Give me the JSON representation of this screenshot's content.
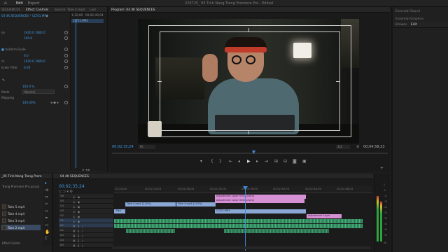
{
  "menu": {
    "home_label": "",
    "edit": "Edit",
    "export": "Export"
  },
  "app_title": "220725_ 05 Tinh Nang Trong Premiere Pro - Edited",
  "left_panel": {
    "tabs": [
      "SEQUENCES",
      "Effect Controls",
      "Source: Take 4.mp4",
      "Lum"
    ],
    "source_label": "04 4K SEQUENCES",
    "clip_label": "04 4K SEQUENCES * CLT01.MP4",
    "timecode_in": "1;32;00",
    "timecode_out": "00;02;40;04",
    "clip_strip": "CLT01.MP4",
    "properties": [
      {
        "label": "on",
        "value": "1920.0   1080.0"
      },
      {
        "label": "",
        "value": "100.0"
      },
      {
        "label": "",
        "value": ""
      },
      {
        "label": "",
        "value": "Uniform Scale"
      },
      {
        "label": "",
        "value": "0.0"
      },
      {
        "label": "nt",
        "value": "1920.0   1080.0"
      },
      {
        "label": "licker Filter",
        "value": "0.00"
      }
    ],
    "opacity": {
      "value": "100.0 %",
      "blend_label": "Mode",
      "blend_value": "Normal",
      "remap_label": "Mapping"
    },
    "speed": {
      "value": "100.00%"
    }
  },
  "program": {
    "tab": "Program: 04 4K SEQUENCES",
    "timecode_current": "00;02;35;24",
    "fit": "Fit",
    "quality": "1/2",
    "timecode_total": "00;04;58;23"
  },
  "right_panel": {
    "title1": "Essential Sound",
    "title2": "Essential Graphics",
    "tab_browse": "Browse",
    "tab_edit": "Edit"
  },
  "project": {
    "tab": "_05 Tinh Nang Trong Prem",
    "subtitle": "Trong Premiere Pro.prproj",
    "items": [
      "Take 5.mp4",
      "Take 4.mp4",
      "Take 3.mp4",
      "Take 2.mp4"
    ],
    "footer": "Effect Folder"
  },
  "timeline": {
    "tab": "04 4K SEQUENCES",
    "timecode": "00;02;35;24",
    "ruler_labels": [
      "02;20;04",
      "00;02;24;04",
      "00;02;28;04",
      "00;02;32;04",
      "00;02;36;04",
      "00;02;40;04",
      "00;02;44;04",
      "00;02;48;04"
    ],
    "tracks": [
      "V6",
      "V5",
      "V4",
      "V3",
      "V2",
      "V1",
      "A1",
      "A2",
      "A3",
      "A4",
      "A5"
    ],
    "clips": {
      "adj1": "Adjustment Layer 0004.prproj",
      "adj2": "Adjustment Layer 0004.prproj",
      "take_a": "Take 4.mp4 [110%]",
      "take_b": "Take 4.mp4 [110%]",
      "v1_a": "Take",
      "v1_b": "CLT01.MP4",
      "adj_layer": "Adjustment Layer"
    }
  },
  "meter": {
    "labels": [
      "0",
      "-6",
      "-12",
      "-18",
      "-24",
      "-30",
      "-36",
      "-42",
      "-48",
      "-54",
      "dB"
    ]
  },
  "colors": {
    "accent": "#3f9be6",
    "video_clip": "#8aa7d6",
    "pink_clip": "#d691d5",
    "audio_clip": "#3a9c6a"
  }
}
